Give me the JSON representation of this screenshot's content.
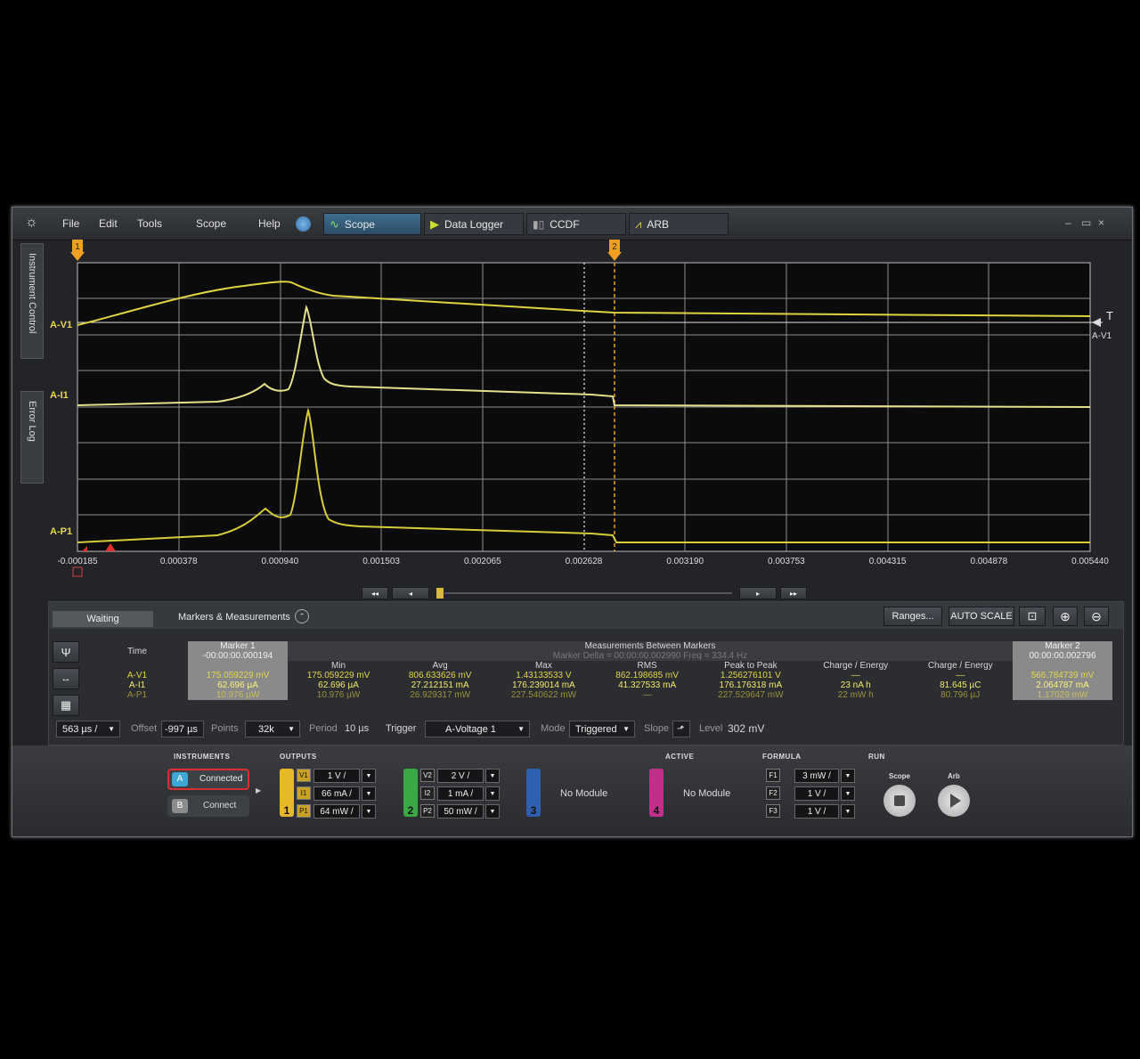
{
  "menu": {
    "file": "File",
    "edit": "Edit",
    "tools": "Tools",
    "scope": "Scope",
    "help": "Help"
  },
  "tabs": {
    "scope": "Scope",
    "data_logger": "Data Logger",
    "ccdf": "CCDF",
    "arb": "ARB"
  },
  "window_controls": {
    "minimize": "–",
    "maximize": "▭",
    "close": "×"
  },
  "side_tabs": {
    "instrument_control": "Instrument Control",
    "error_log": "Error Log"
  },
  "scope": {
    "markers": {
      "m1": "1",
      "m2": "2"
    },
    "channels": {
      "v1": "A-V1",
      "i1": "A-I1",
      "p1": "A-P1",
      "right_v1": "A-V1"
    },
    "x_ticks": [
      "-0.000185",
      "0.000378",
      "0.000940",
      "0.001503",
      "0.002065",
      "0.002628",
      "0.003190",
      "0.003753",
      "0.004315",
      "0.004878",
      "0.005440"
    ],
    "nav": {
      "first": "◂◂",
      "prev": "◂",
      "next": "▸",
      "last": "▸▸"
    },
    "colors": {
      "trace": "#e0d33f",
      "marker": "#f0a020",
      "grid": "#9a9a9a"
    }
  },
  "panel": {
    "status": "Waiting",
    "markers_label": "Markers & Measurements",
    "ranges": "Ranges...",
    "autoscale": "AUTO SCALE",
    "table": {
      "time_label": "Time",
      "marker1_label": "Marker 1",
      "marker1_time": "-00:00:00.000194",
      "between_label": "Measurements Between Markers",
      "delta": "Marker Delta = 00:00:00.002990   Freq = 334.4 Hz",
      "marker2_label": "Marker 2",
      "marker2_time": "00:00:00.002796",
      "columns": [
        "Min",
        "Avg",
        "Max",
        "RMS",
        "Peak to Peak",
        "Charge / Energy",
        "Charge / Energy"
      ],
      "rows": [
        {
          "name": "A-V1",
          "m1": "175.059229 mV",
          "vals": [
            "175.059229 mV",
            "806.633626 mV",
            "1.43133533 V",
            "862.198685 mV",
            "1.256276101 V",
            "—",
            "—"
          ],
          "m2": "566.784739 mV"
        },
        {
          "name": "A-I1",
          "m1": "62.696 µA",
          "vals": [
            "62.696 µA",
            "27.212151 mA",
            "176.239014 mA",
            "41.327533 mA",
            "176.176318 mA",
            "23 nA h",
            "81.645 µC"
          ],
          "m2": "2.064787 mA"
        },
        {
          "name": "A-P1",
          "m1": "10.976 µW",
          "vals": [
            "10.976 µW",
            "26.929317 mW",
            "227.540622 mW",
            "—",
            "227.529647 mW",
            "22 mW h",
            "80.796 µJ"
          ],
          "m2": "1.17029 mW"
        }
      ]
    },
    "controls": {
      "timebase": "563 µs /",
      "offset_label": "Offset",
      "offset_value": "-997 µs",
      "points_label": "Points",
      "points_value": "32k",
      "period_label": "Period",
      "period_value": "10 µs",
      "trigger_label": "Trigger",
      "trigger_value": "A-Voltage 1",
      "mode_label": "Mode",
      "mode_value": "Triggered",
      "slope_label": "Slope",
      "level_label": "Level",
      "level_value": "302 mV"
    }
  },
  "bottom": {
    "instruments_label": "INSTRUMENTS",
    "inst_a": {
      "letter": "A",
      "status": "Connected"
    },
    "inst_b": {
      "letter": "B",
      "status": "Connect"
    },
    "outputs_label": "OUTPUTS",
    "active_label": "ACTIVE",
    "formula_label": "FORMULA",
    "run_label": "RUN",
    "ch1": {
      "num": "1",
      "tags": [
        "V1",
        "I1",
        "P1"
      ],
      "vals": [
        "1 V /",
        "66 mA /",
        "64 mW /"
      ],
      "color": "#e6b82a"
    },
    "ch2": {
      "num": "2",
      "tags": [
        "V2",
        "I2",
        "P2"
      ],
      "vals": [
        "2 V /",
        "1 mA /",
        "50 mW /"
      ],
      "color": "#3aa845"
    },
    "ch3": {
      "num": "3",
      "label": "No Module",
      "color": "#2f5fb0"
    },
    "ch4": {
      "num": "4",
      "label": "No Module",
      "color": "#c0308a"
    },
    "formula": {
      "tags": [
        "F1",
        "F2",
        "F3"
      ],
      "vals": [
        "3 mW /",
        "1 V /",
        "1 V /"
      ]
    },
    "run": {
      "scope": "Scope",
      "arb": "Arb"
    }
  }
}
